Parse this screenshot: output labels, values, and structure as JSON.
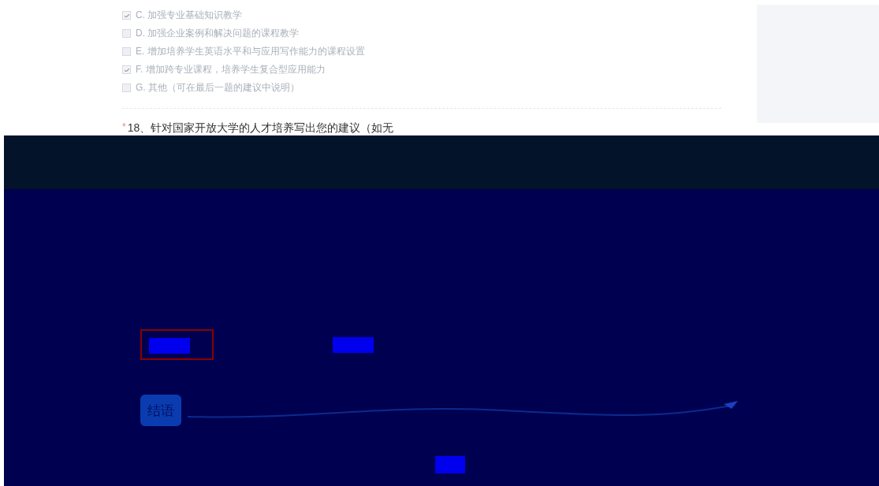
{
  "options": [
    {
      "label": "C. 加强专业基础知识教学",
      "checked": true
    },
    {
      "label": "D. 加强企业案例和解决问题的课程教学",
      "checked": false
    },
    {
      "label": "E. 增加培养学生英语水平和与应用写作能力的课程设置",
      "checked": false
    },
    {
      "label": "F. 增加跨专业课程，培养学生复合型应用能力",
      "checked": true
    },
    {
      "label": "G. 其他（可在最后一题的建议中说明）",
      "checked": false
    }
  ],
  "question": {
    "required": true,
    "required_mark": "*",
    "text": "18、针对国家开放大学的人才培养写出您的建议（如无"
  },
  "closing": {
    "badge": "结语"
  }
}
